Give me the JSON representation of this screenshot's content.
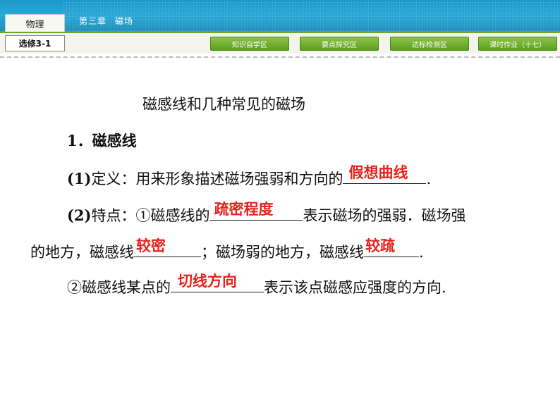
{
  "header": {
    "subject": "物理",
    "chapter": "第三章",
    "topic": "磁场",
    "course": "选修3-1",
    "nav": [
      "知识自学区",
      "要点探究区",
      "达标检测区",
      "课时作业（十七）"
    ]
  },
  "content": {
    "heading": "磁感线和几种常见的磁场",
    "section1": "1．磁感线",
    "def_num": "(1)",
    "def_text": "定义：用来形象描述磁场强弱和方向的",
    "def_answer": "假想曲线",
    "def_end": ".",
    "feat_num": "(2)",
    "feat_text": "特点：①磁感线的",
    "feat_answer": "疏密程度",
    "feat_tail": "表示磁场的强弱．磁场强",
    "line4_a": "的地方，磁感线",
    "line4_ans1": "较密",
    "line4_b": "；磁场弱的地方，磁感线",
    "line4_ans2": "较疏",
    "line4_end": ".",
    "line5_a": "②磁感线某点的",
    "line5_ans": "切线方向",
    "line5_b": "表示该点磁感应强度的方向."
  }
}
